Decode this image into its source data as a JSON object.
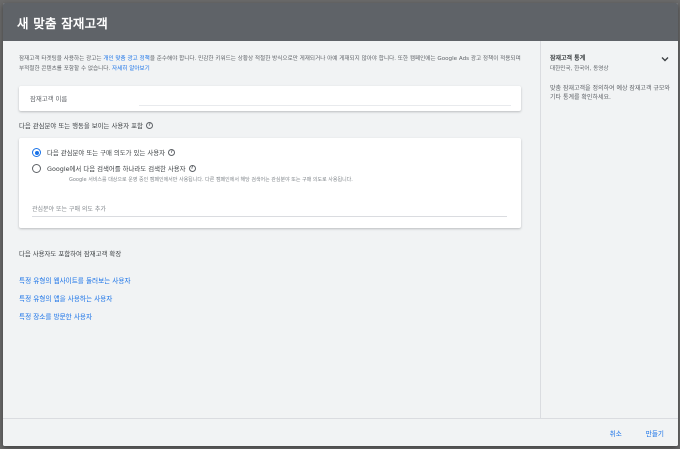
{
  "dialog": {
    "title": "새 맞춤 잠재고객"
  },
  "intro": {
    "text_before_link": "잠재고객 타겟팅을 사용하는 광고는 ",
    "policy_link": "개인 맞춤 광고 정책",
    "text_after_link": "을 준수해야 합니다. 민감한 키워드는 상황상 적절한 방식으로만 게재되거나 아예 게재되지 않아야 합니다. 또한 캠페인에는 Google Ads 광고 정책이 적용되며 부적절한 콘텐츠를 포함할 수 없습니다.",
    "learn_more": "자세히 알아보기"
  },
  "name_field": {
    "label": "잠재고객 이름"
  },
  "interest_section": {
    "label": "다음 관심분야 또는 행동을 보이는 사용자 포함",
    "help_icon": "?",
    "options": [
      {
        "label": "다음 관심분야 또는 구매 의도가 있는 사용자",
        "selected": true,
        "help": "?"
      },
      {
        "label": "Google에서 다음 검색어를 하나라도 검색한 사용자",
        "selected": false,
        "help": "?",
        "sub": "Google 서비스를 대상으로 운영 중인 캠페인에서만 사용됩니다. 다른 캠페인에서 해당 검색어는 관심분야 또는 구매 의도로 사용됩니다."
      }
    ],
    "input_placeholder": "관심분야 또는 구매 의도 추가"
  },
  "expand_section": {
    "label": "다음 사용자도 포함하여 잠재고객 확장",
    "links": [
      "특정 유형의 웹사이트를 둘러보는 사용자",
      "특정 유형의 앱을 사용하는 사용자",
      "특정 장소를 방문한 사용자"
    ]
  },
  "side_panel": {
    "title": "잠재고객 통계",
    "subtitle": "대한민국, 한국어, 동영상",
    "chevron_icon": "chevron-down-icon",
    "description": "맞춤 잠재고객을 정의하여 예상 잠재고객 규모와 기타 통계를 확인하세요."
  },
  "footer": {
    "cancel": "취소",
    "create": "만들기"
  },
  "colors": {
    "accent": "#1a73e8",
    "title_bar": "#5f6368",
    "panel_bg": "#f1f3f4"
  }
}
